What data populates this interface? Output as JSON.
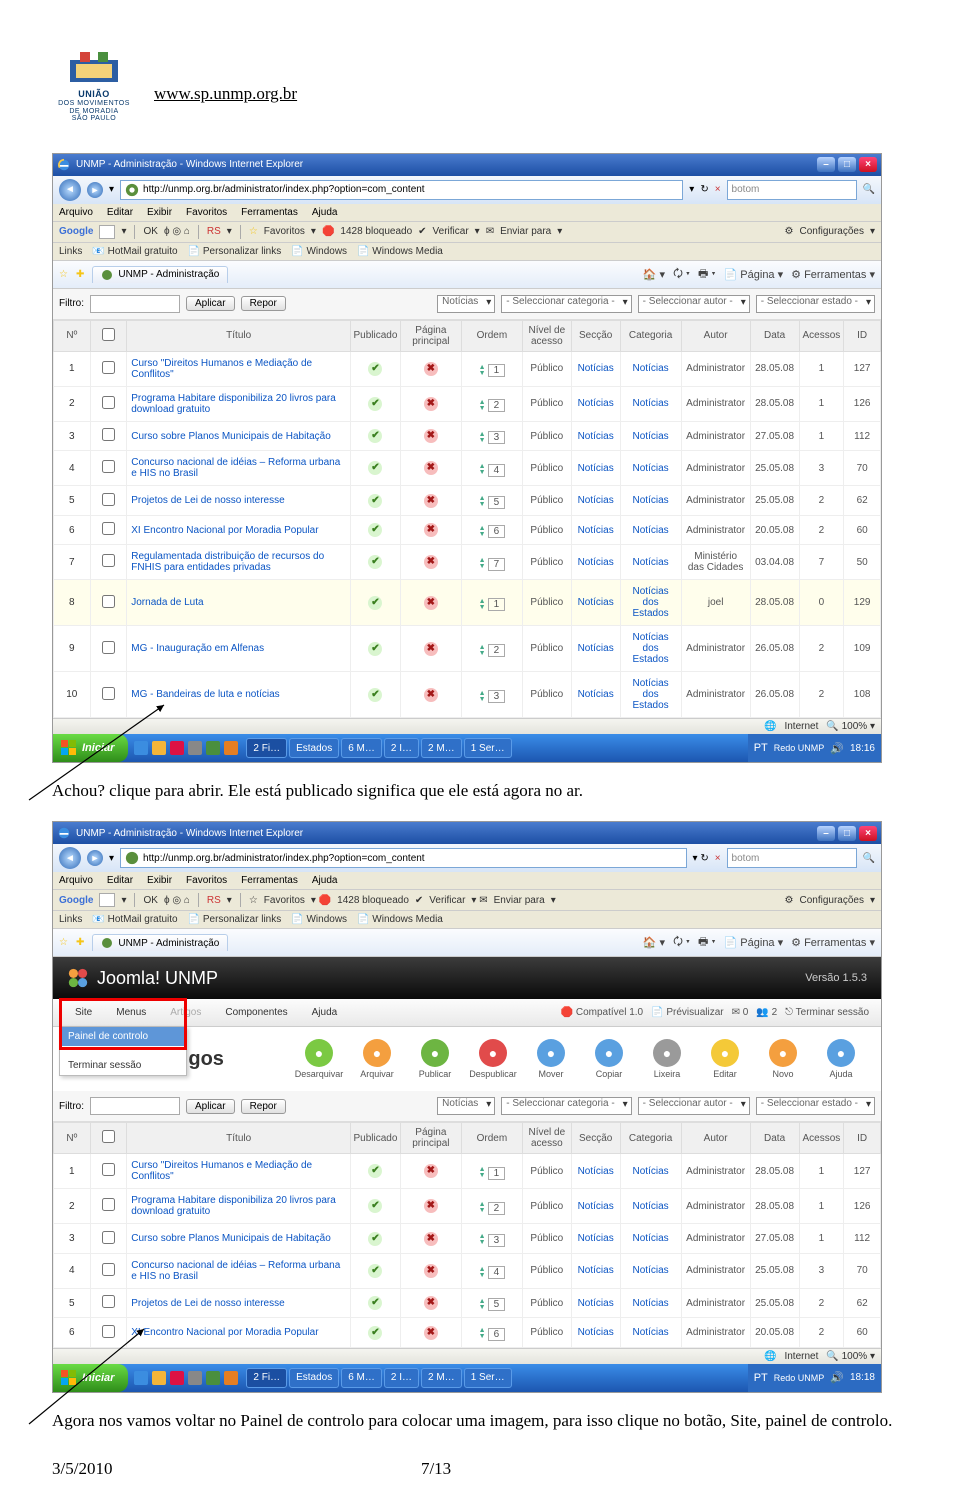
{
  "header_url": "www.sp.unmp.org.br",
  "logo": {
    "line1": "UNIÃO",
    "line2": "DOS MOVIMENTOS",
    "line3": "DE MORADIA",
    "line4": "SÃO PAULO"
  },
  "browser": {
    "title": "UNMP - Administração - Windows Internet Explorer",
    "url": "http://unmp.org.br/administrator/index.php?option=com_content",
    "search_placeholder": "botom",
    "menu": [
      "Arquivo",
      "Editar",
      "Exibir",
      "Favoritos",
      "Ferramentas",
      "Ajuda"
    ],
    "google_bar": {
      "brand": "Google",
      "ok": "OK",
      "rs": "RS",
      "fav": "Favoritos",
      "blocked": "1428 bloqueado",
      "verificar": "Verificar",
      "enviar": "Enviar para",
      "config": "Configurações"
    },
    "links_bar": {
      "label": "Links",
      "items": [
        "HotMail gratuito",
        "Personalizar links",
        "Windows",
        "Windows Media"
      ]
    },
    "tab_label": "UNMP - Administração",
    "tab_tools": {
      "pagina": "Página",
      "ferramentas": "Ferramentas"
    },
    "status": {
      "internet": "Internet",
      "zoom": "100%"
    },
    "start": "Iniciar",
    "task_items": [
      "2 Fi…",
      "Estados",
      "6 M…",
      "2 I…",
      "2 M…",
      "1 Ser…"
    ],
    "tray": {
      "lang": "PT",
      "redo": "Redo UNMP",
      "time": "18:16",
      "time2": "18:18"
    }
  },
  "grid": {
    "filter_label": "Filtro:",
    "apply": "Aplicar",
    "reset": "Repor",
    "section_sel": "Notícias",
    "cat_sel": "- Seleccionar categoria -",
    "author_sel": "- Seleccionar autor -",
    "state_sel": "- Seleccionar estado -",
    "headers": {
      "n": "Nº",
      "chk": "",
      "titulo": "Título",
      "pub": "Publicado",
      "pp": "Página principal",
      "ord": "Ordem",
      "nivel": "Nível de acesso",
      "sec": "Secção",
      "cat": "Categoria",
      "autor": "Autor",
      "data": "Data",
      "ac": "Acessos",
      "id": "ID"
    },
    "rows": [
      {
        "n": "1",
        "title": "Curso \"Direitos Humanos e Mediação de Conflitos\"",
        "ord": "1",
        "sec": "Notícias",
        "cat": "Notícias",
        "autor": "Administrator",
        "data": "28.05.08",
        "ac": "1",
        "id": "127"
      },
      {
        "n": "2",
        "title": "Programa Habitare disponibiliza 20 livros para download gratuito",
        "ord": "2",
        "sec": "Notícias",
        "cat": "Notícias",
        "autor": "Administrator",
        "data": "28.05.08",
        "ac": "1",
        "id": "126"
      },
      {
        "n": "3",
        "title": "Curso sobre Planos Municipais de Habitação",
        "ord": "3",
        "sec": "Notícias",
        "cat": "Notícias",
        "autor": "Administrator",
        "data": "27.05.08",
        "ac": "1",
        "id": "112"
      },
      {
        "n": "4",
        "title": "Concurso nacional de idéias – Reforma urbana e HIS no Brasil",
        "ord": "4",
        "sec": "Notícias",
        "cat": "Notícias",
        "autor": "Administrator",
        "data": "25.05.08",
        "ac": "3",
        "id": "70"
      },
      {
        "n": "5",
        "title": "Projetos de Lei de nosso interesse",
        "ord": "5",
        "sec": "Notícias",
        "cat": "Notícias",
        "autor": "Administrator",
        "data": "25.05.08",
        "ac": "2",
        "id": "62"
      },
      {
        "n": "6",
        "title": "XI Encontro Nacional por Moradia Popular",
        "ord": "6",
        "sec": "Notícias",
        "cat": "Notícias",
        "autor": "Administrator",
        "data": "20.05.08",
        "ac": "2",
        "id": "60"
      },
      {
        "n": "7",
        "title": "Regulamentada distribuição de recursos do FNHIS para entidades privadas",
        "ord": "7",
        "sec": "Notícias",
        "cat": "Notícias",
        "autor": "Ministério das Cidades",
        "data": "03.04.08",
        "ac": "7",
        "id": "50"
      },
      {
        "n": "8",
        "title": "Jornada de Luta",
        "ord": "1",
        "sec": "Notícias",
        "cat": "Notícias dos Estados",
        "autor": "joel",
        "data": "28.05.08",
        "ac": "0",
        "id": "129",
        "hl": true
      },
      {
        "n": "9",
        "title": "MG - Inauguração em Alfenas",
        "ord": "2",
        "sec": "Notícias",
        "cat": "Notícias dos Estados",
        "autor": "Administrator",
        "data": "26.05.08",
        "ac": "2",
        "id": "109"
      },
      {
        "n": "10",
        "title": "MG - Bandeiras de luta e notícias",
        "ord": "3",
        "sec": "Notícias",
        "cat": "Notícias dos Estados",
        "autor": "Administrator",
        "data": "26.05.08",
        "ac": "2",
        "id": "108"
      }
    ],
    "rows2": [
      {
        "n": "1",
        "title": "Curso \"Direitos Humanos e Mediação de Conflitos\"",
        "ord": "1",
        "sec": "Notícias",
        "cat": "Notícias",
        "autor": "Administrator",
        "data": "28.05.08",
        "ac": "1",
        "id": "127"
      },
      {
        "n": "2",
        "title": "Programa Habitare disponibiliza 20 livros para download gratuito",
        "ord": "2",
        "sec": "Notícias",
        "cat": "Notícias",
        "autor": "Administrator",
        "data": "28.05.08",
        "ac": "1",
        "id": "126"
      },
      {
        "n": "3",
        "title": "Curso sobre Planos Municipais de Habitação",
        "ord": "3",
        "sec": "Notícias",
        "cat": "Notícias",
        "autor": "Administrator",
        "data": "27.05.08",
        "ac": "1",
        "id": "112"
      },
      {
        "n": "4",
        "title": "Concurso nacional de idéias – Reforma urbana e HIS no Brasil",
        "ord": "4",
        "sec": "Notícias",
        "cat": "Notícias",
        "autor": "Administrator",
        "data": "25.05.08",
        "ac": "3",
        "id": "70"
      },
      {
        "n": "5",
        "title": "Projetos de Lei de nosso interesse",
        "ord": "5",
        "sec": "Notícias",
        "cat": "Notícias",
        "autor": "Administrator",
        "data": "25.05.08",
        "ac": "2",
        "id": "62"
      },
      {
        "n": "6",
        "title": "XI Encontro Nacional por Moradia Popular",
        "ord": "6",
        "sec": "Notícias",
        "cat": "Notícias",
        "autor": "Administrator",
        "data": "20.05.08",
        "ac": "2",
        "id": "60"
      }
    ]
  },
  "joomla": {
    "brand": "Joomla! UNMP",
    "version": "Versão 1.5.3",
    "nav": [
      "Site",
      "Menus",
      "Artigos",
      "Componentes",
      "Ajuda"
    ],
    "status_items": {
      "comp": "Compatível 1.0",
      "prev": "Prévisualizar",
      "msg": "0",
      "users": "2",
      "logout": "Terminar sessão"
    },
    "drop": [
      "Painel de controlo",
      "",
      "Terminar sessão"
    ],
    "page_title": "r de artigos",
    "toolbar_btns": [
      {
        "name": "Desarquivar",
        "bg": "#7bc943"
      },
      {
        "name": "Arquivar",
        "bg": "#f49f3f"
      },
      {
        "name": "Publicar",
        "bg": "#6db542"
      },
      {
        "name": "Despublicar",
        "bg": "#e14b4b"
      },
      {
        "name": "Mover",
        "bg": "#5aa0e0"
      },
      {
        "name": "Copiar",
        "bg": "#5aa0e0"
      },
      {
        "name": "Lixeira",
        "bg": "#9a9a9a"
      },
      {
        "name": "Editar",
        "bg": "#f4c938"
      },
      {
        "name": "Novo",
        "bg": "#f49f3f"
      },
      {
        "name": "Ajuda",
        "bg": "#5aa0e0"
      }
    ]
  },
  "caption1": "Achou? clique para abrir. Ele está publicado significa que ele está agora no ar.",
  "caption2": "Agora nos vamos voltar no Painel de controlo para colocar uma imagem, para isso clique no botão, Site, painel de controlo.",
  "pub_label": "Público",
  "footer": {
    "date": "3/5/2010",
    "page": "7/13"
  }
}
